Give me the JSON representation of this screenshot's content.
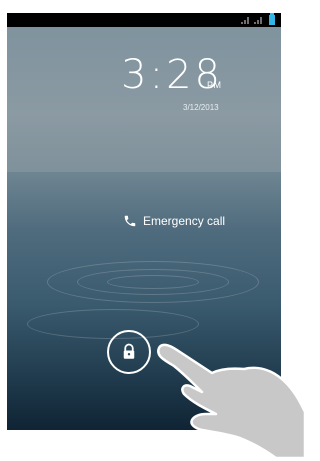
{
  "lockscreen": {
    "time": "3:28",
    "ampm": "PM",
    "date": "3/12/2013",
    "emergency_label": "Emergency call"
  },
  "status_bar": {
    "icons": [
      "signal-icon",
      "signal-icon",
      "battery-icon"
    ],
    "battery_color": "#33b5e5"
  },
  "unlock": {
    "icon": "lock-icon"
  },
  "overlay": {
    "icon": "pointing-hand-icon"
  }
}
